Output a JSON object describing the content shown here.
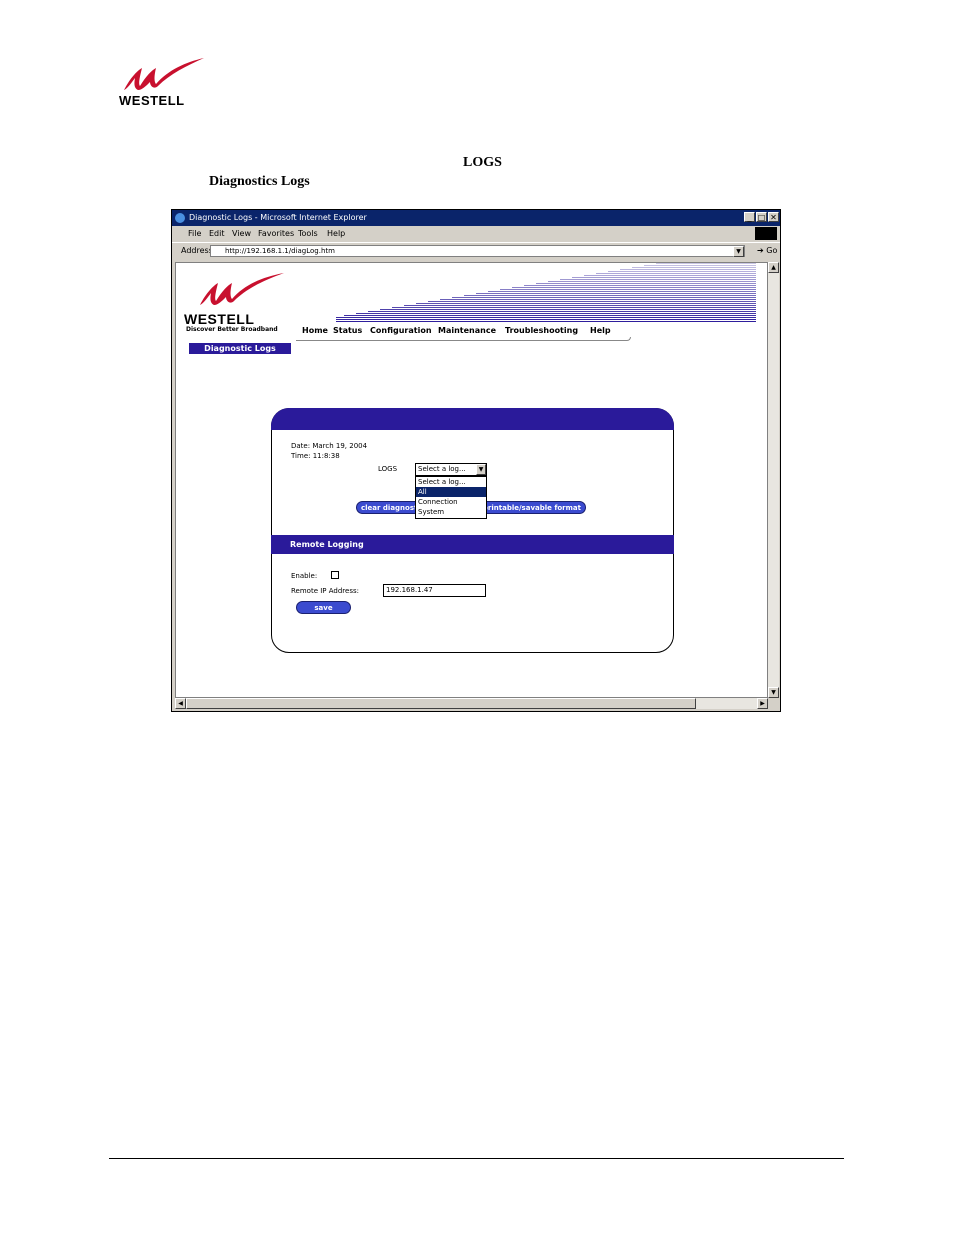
{
  "document": {
    "brand": "WESTELL",
    "heading_logs": "LOGS",
    "heading_diagnostics": "Diagnostics Logs"
  },
  "browser": {
    "title": "Diagnostic Logs - Microsoft Internet Explorer",
    "menu": [
      "File",
      "Edit",
      "View",
      "Favorites",
      "Tools",
      "Help"
    ],
    "address_label": "Address",
    "address": "http://192.168.1.1/diagLog.htm",
    "go": "Go"
  },
  "page": {
    "brand": "WESTELL",
    "tagline": "Discover Better Broadband",
    "nav": [
      "Home",
      "Status",
      "Configuration",
      "Maintenance",
      "Troubleshooting",
      "Help"
    ],
    "tab": "Diagnostic Logs",
    "date": "Date: March 19, 2004",
    "time": "Time: 11:8:38",
    "logs_label": "LOGS",
    "logs_selected": "Select a log...",
    "logs_options": [
      "Select a log...",
      "All",
      "Connection",
      "System"
    ],
    "clear_button": "clear diagnostic log",
    "printable_button": "printable/savable format",
    "remote_heading": "Remote Logging",
    "enable_label": "Enable:",
    "remote_ip_label": "Remote IP Address:",
    "remote_ip_value": "192.168.1.47",
    "save_button": "save"
  },
  "colors": {
    "title_bar": "#0a246a",
    "panel_header": "#2a1a9a",
    "button": "#3b4bcf",
    "logo_red": "#c8102e"
  }
}
